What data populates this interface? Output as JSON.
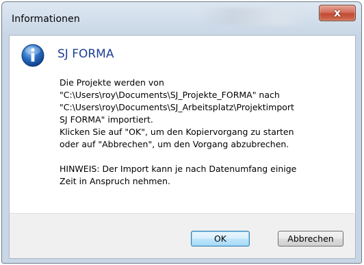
{
  "window": {
    "title": "Informationen",
    "close_glyph": "x",
    "close_icon": "close-icon"
  },
  "message": {
    "icon": "info-icon",
    "heading": "SJ FORMA",
    "lines": [
      "Die Projekte werden von",
      "\"C:\\Users\\roy\\Documents\\SJ_Projekte_FORMA\" nach",
      "\"C:\\Users\\roy\\Documents\\SJ_Arbeitsplatz\\Projektimport",
      "SJ FORMA\" importiert.",
      "Klicken Sie auf \"OK\", um den Kopiervorgang zu starten",
      "oder auf \"Abbrechen\", um den Vorgang abzubrechen."
    ],
    "note_lines": [
      "HINWEIS: Der Import kann je nach Datenumfang einige",
      "Zeit in Anspruch nehmen."
    ]
  },
  "buttons": {
    "ok_label": "OK",
    "cancel_label": "Abbrechen"
  },
  "colors": {
    "heading": "#1b3f95",
    "close_button": "#c24a34",
    "info_icon": "#1f62b8",
    "footer_bg": "#f0f0f0"
  }
}
